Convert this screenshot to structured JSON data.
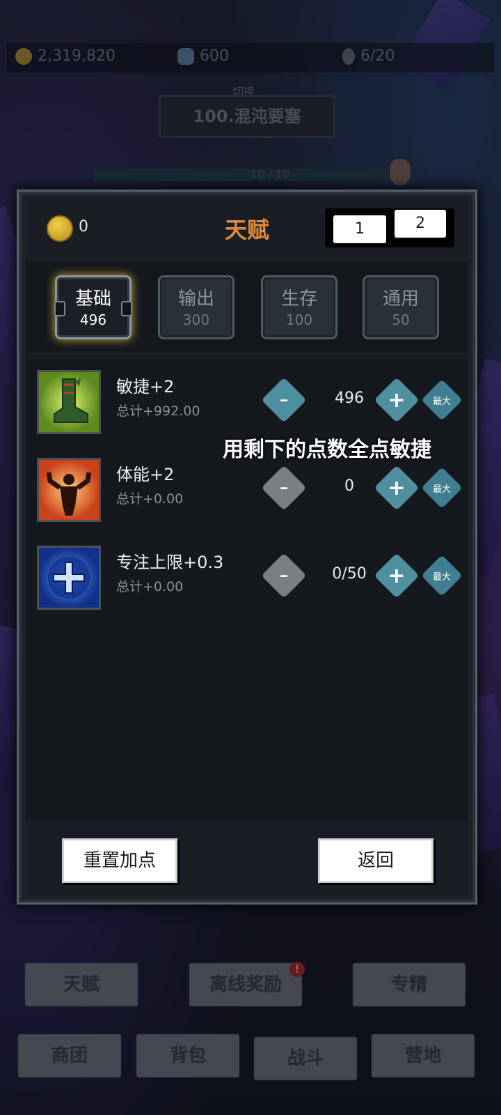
{
  "resources": {
    "gold": "2,319,820",
    "gems": "600",
    "capacity": "6/20"
  },
  "stage": {
    "switch_label": "切换",
    "current": "100.混沌要塞",
    "progress_text": "10 / 10"
  },
  "talent_panel": {
    "title": "天赋",
    "talent_points": "0",
    "page_tabs": [
      "1",
      "2"
    ],
    "categories": [
      {
        "name": "基础",
        "value": "496",
        "active": true
      },
      {
        "name": "输出",
        "value": "300",
        "active": false
      },
      {
        "name": "生存",
        "value": "100",
        "active": false
      },
      {
        "name": "通用",
        "value": "50",
        "active": false
      }
    ],
    "stats": [
      {
        "name": "敏捷+2",
        "total": "总计+992.00",
        "count": "496",
        "max_label": "最大",
        "icon": "boot-icon"
      },
      {
        "name": "体能+2",
        "total": "总计+0.00",
        "count": "0",
        "max_label": "最大",
        "icon": "muscle-icon"
      },
      {
        "name": "专注上限+0.3",
        "total": "总计+0.00",
        "count": "0/50",
        "max_label": "最大",
        "icon": "plus-cross-icon"
      }
    ],
    "reset_label": "重置加点",
    "back_label": "返回"
  },
  "overlay_caption": "用剩下的点数全点敏捷",
  "bottom_nav": {
    "row1": [
      {
        "label": "天赋"
      },
      {
        "label": "离线奖励",
        "badge": "!"
      },
      {
        "label": "专精"
      }
    ],
    "row2": [
      {
        "label": "商团"
      },
      {
        "label": "背包"
      },
      {
        "label": "战斗"
      },
      {
        "label": "营地"
      }
    ]
  },
  "colors": {
    "title_orange": "#e08a3a",
    "button_teal": "#4f8fa0",
    "button_disabled": "#7b7f84",
    "active_glow": "#c9a83a"
  }
}
